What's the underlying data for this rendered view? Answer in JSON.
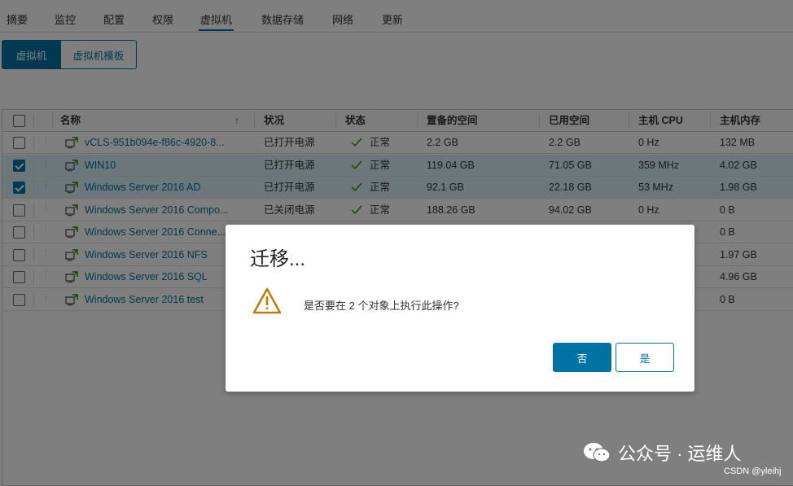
{
  "topnav": {
    "tabs": [
      "摘要",
      "监控",
      "配置",
      "权限",
      "虚拟机",
      "数据存储",
      "网络",
      "更新"
    ],
    "active_index": 4
  },
  "subtabs": {
    "vms": "虚拟机",
    "templates": "虚拟机模板"
  },
  "grid": {
    "columns": [
      "名称",
      "状况",
      "状态",
      "置备的空间",
      "已用空间",
      "主机 CPU",
      "主机内存"
    ],
    "sort_indicator": "↑",
    "rows": [
      {
        "checked": false,
        "name": "vCLS-951b094e-f86c-4920-8...",
        "condition": "已打开电源",
        "status": "正常",
        "provisioned": "2.2 GB",
        "used": "2.2 GB",
        "cpu": "0 Hz",
        "mem": "132 MB"
      },
      {
        "checked": true,
        "name": "WIN10",
        "condition": "已打开电源",
        "status": "正常",
        "provisioned": "119.04 GB",
        "used": "71.05 GB",
        "cpu": "359 MHz",
        "mem": "4.02 GB"
      },
      {
        "checked": true,
        "name": "Windows Server 2016 AD",
        "condition": "已打开电源",
        "status": "正常",
        "provisioned": "92.1 GB",
        "used": "22.18 GB",
        "cpu": "53 MHz",
        "mem": "1.98 GB"
      },
      {
        "checked": false,
        "name": "Windows Server 2016 Compo...",
        "condition": "已关闭电源",
        "status": "正常",
        "provisioned": "188.26 GB",
        "used": "94.02 GB",
        "cpu": "0 Hz",
        "mem": "0 B"
      },
      {
        "checked": false,
        "name": "Windows Server 2016 Conne...",
        "condition": "",
        "status": "",
        "provisioned": "",
        "used": "",
        "cpu": "",
        "mem": "0 B"
      },
      {
        "checked": false,
        "name": "Windows Server 2016 NFS",
        "condition": "",
        "status": "",
        "provisioned": "",
        "used": "",
        "cpu": "",
        "mem": "1.97 GB"
      },
      {
        "checked": false,
        "name": "Windows Server 2016 SQL",
        "condition": "",
        "status": "",
        "provisioned": "",
        "used": "",
        "cpu": "",
        "mem": "4.96 GB"
      },
      {
        "checked": false,
        "name": "Windows Server 2016 test",
        "condition": "",
        "status": "",
        "provisioned": "",
        "used": "",
        "cpu": "",
        "mem": "0 B"
      }
    ]
  },
  "dialog": {
    "title": "迁移...",
    "message": "是否要在 2 个对象上执行此操作?",
    "no_label": "否",
    "yes_label": "是"
  },
  "watermark": {
    "brand": "公众号 · 运维人",
    "credit": "CSDN @yleihj"
  },
  "colors": {
    "accent": "#0072a3",
    "ok": "#2f8400",
    "warning": "#c27b00"
  }
}
